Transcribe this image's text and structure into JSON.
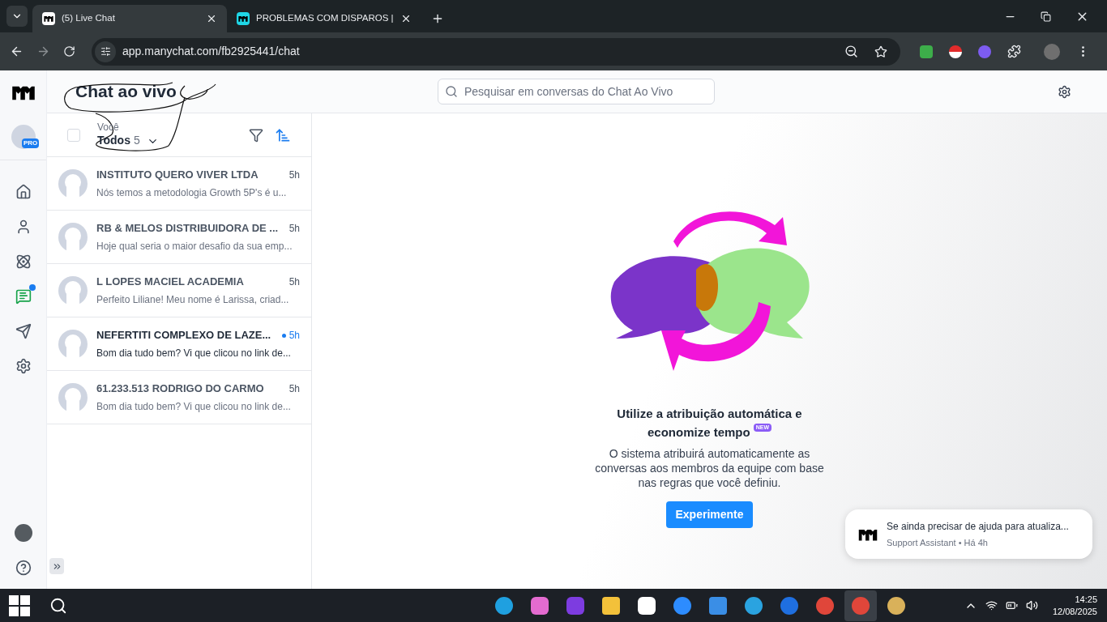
{
  "browser": {
    "tabs": [
      {
        "title": "(5) Live Chat",
        "selected": true
      },
      {
        "title": "PROBLEMAS COM DISPAROS |",
        "selected": false
      }
    ],
    "address": "app.manychat.com/fb2925441/chat"
  },
  "app": {
    "title": "Chat ao vivo",
    "search_placeholder": "Pesquisar em conversas do Chat Ao Vivo",
    "profile_badge": "PRO",
    "nav": [
      {
        "kind": "home",
        "selected": false,
        "dot": false
      },
      {
        "kind": "contacts",
        "selected": false,
        "dot": false
      },
      {
        "kind": "automation",
        "selected": false,
        "dot": false
      },
      {
        "kind": "chat",
        "selected": true,
        "dot": true
      },
      {
        "kind": "broadcast",
        "selected": false,
        "dot": false
      },
      {
        "kind": "settings",
        "selected": false,
        "dot": false
      }
    ],
    "filter": {
      "checked": false,
      "label": "Você",
      "value": "Todos",
      "count": "5"
    },
    "conversations": [
      {
        "name": "INSTITUTO QUERO VIVER LTDA",
        "preview": "Nós temos a metodologia Growth 5P's é u...",
        "time": "5h",
        "unread": false
      },
      {
        "name": "RB & MELOS DISTRIBUIDORA DE ...",
        "preview": "Hoje qual seria o maior desafio da sua emp...",
        "time": "5h",
        "unread": false
      },
      {
        "name": "L LOPES MACIEL ACADEMIA",
        "preview": "Perfeito Liliane! Meu nome é Larissa, criad...",
        "time": "5h",
        "unread": false
      },
      {
        "name": "NEFERTITI COMPLEXO DE LAZE...",
        "preview": "Bom dia tudo bem? Vi que clicou no link de...",
        "time": "5h",
        "unread": true
      },
      {
        "name": "61.233.513 RODRIGO DO CARMO",
        "preview": "Bom dia tudo bem? Vi que clicou no link de...",
        "time": "5h",
        "unread": false
      }
    ],
    "empty_state": {
      "title_line_1": "Utilize a atribuição automática e",
      "title_line_2": "economize tempo",
      "badge": "NEW",
      "body": "O sistema atribuirá automaticamente as conversas aos membros da equipe com base nas regras que você definiu.",
      "button": "Experimente"
    },
    "notification": {
      "message": "Se ainda precisar de ajuda para atualiza...",
      "meta": "Support Assistant • Há 4h"
    }
  },
  "taskbar": {
    "apps": [
      {
        "kind": "edge",
        "selected": false
      },
      {
        "kind": "copilot",
        "selected": false
      },
      {
        "kind": "purple",
        "selected": false
      },
      {
        "kind": "folder",
        "selected": false
      },
      {
        "kind": "capcut",
        "selected": false
      },
      {
        "kind": "zoom",
        "selected": false
      },
      {
        "kind": "store",
        "selected": false
      },
      {
        "kind": "telegram",
        "selected": false
      },
      {
        "kind": "bluetooth",
        "selected": false
      },
      {
        "kind": "chrome",
        "selected": false
      },
      {
        "kind": "chrome",
        "selected": true
      },
      {
        "kind": "paint",
        "selected": false
      }
    ],
    "time": "14:25",
    "date": "12/08/2025"
  }
}
